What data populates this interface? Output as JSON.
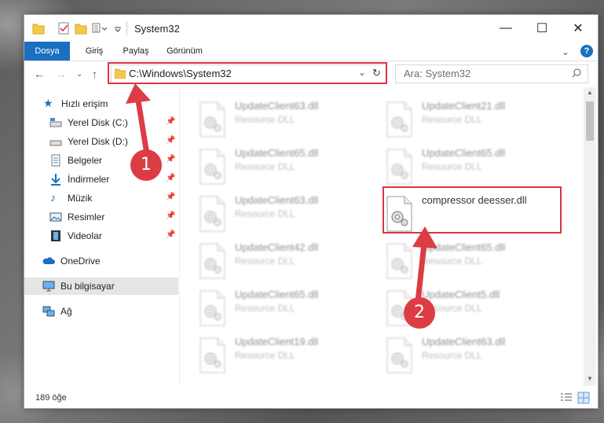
{
  "window": {
    "title": "System32",
    "controls": {
      "minimize": "—",
      "maximize": "☐",
      "close": "✕"
    }
  },
  "ribbon": {
    "tabs": [
      "Dosya",
      "Giriş",
      "Paylaş",
      "Görünüm"
    ],
    "help": "?"
  },
  "address": {
    "path": "C:\\Windows\\System32",
    "search_placeholder": "Ara: System32"
  },
  "nav": {
    "quick_access": "Hızlı erişim",
    "items": [
      "Yerel Disk (C:)",
      "Yerel Disk (D:)",
      "Belgeler",
      "İndirmeler",
      "Müzik",
      "Resimler",
      "Videolar"
    ],
    "onedrive": "OneDrive",
    "this_pc": "Bu bilgisayar",
    "network": "Ağ"
  },
  "files": [
    {
      "name": "UpdateClient63.dll",
      "type": "Resource DLL"
    },
    {
      "name": "UpdateClient21.dll",
      "type": "Resource DLL"
    },
    {
      "name": "UpdateClient65.dll",
      "type": "Resource DLL"
    },
    {
      "name": "UpdateClient65.dll",
      "type": "Resource DLL"
    },
    {
      "name": "UpdateClient63.dll",
      "type": "Resource DLL"
    },
    {
      "name": "compressor deesser.dll",
      "type": ""
    },
    {
      "name": "UpdateClient42.dll",
      "type": "Resource DLL"
    },
    {
      "name": "UpdateClient65.dll",
      "type": "Resource DLL"
    },
    {
      "name": "UpdateClient65.dll",
      "type": "Resource DLL"
    },
    {
      "name": "UpdateClient5.dll",
      "type": "Resource DLL"
    },
    {
      "name": "UpdateClient19.dll",
      "type": "Resource DLL"
    },
    {
      "name": "UpdateClient63.dll",
      "type": "Resource DLL"
    }
  ],
  "status": {
    "count": "189 öğe"
  },
  "callouts": [
    "1",
    "2"
  ],
  "colors": {
    "accent": "#1a6fc2",
    "highlight": "#d9363e",
    "callout": "#dc3c44"
  }
}
